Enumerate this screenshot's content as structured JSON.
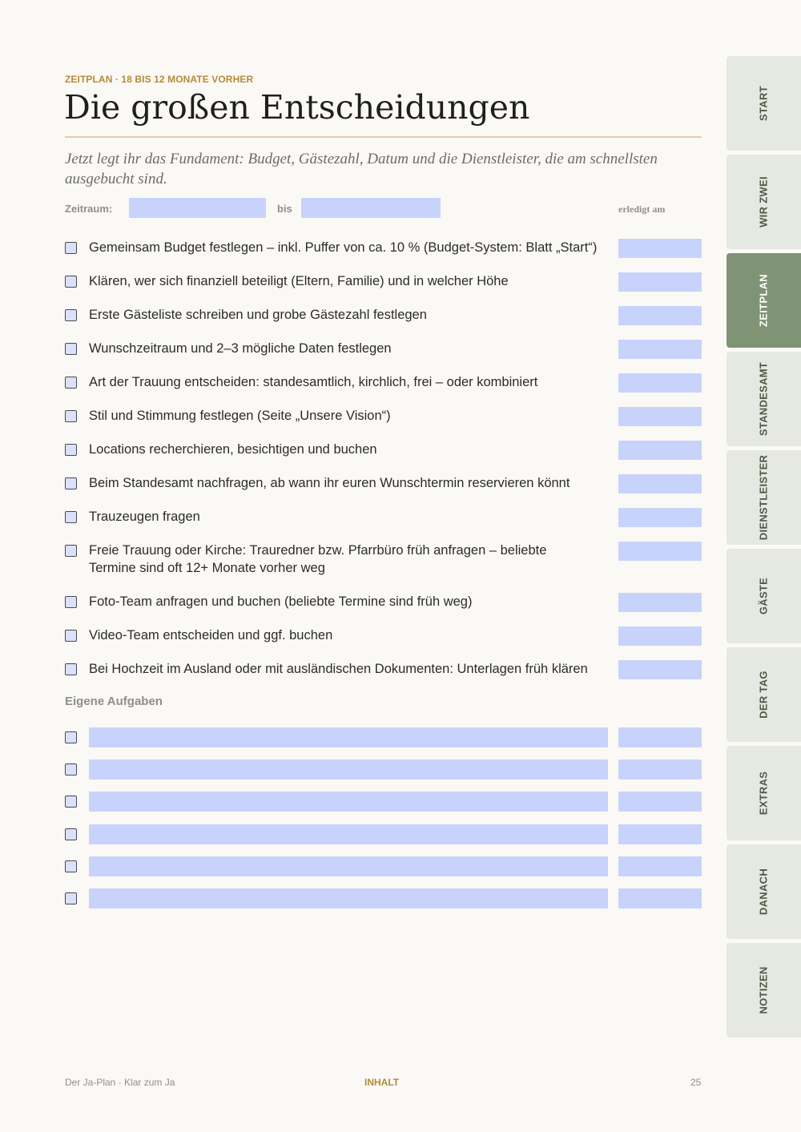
{
  "header": {
    "eyebrow": "ZEITPLAN · 18 BIS 12 MONATE VORHER",
    "title": "Die großen Entscheidungen",
    "intro": "Jetzt legt ihr das Fundament: Budget, Gästezahl, Datum und die Dienstleister, die am schnellsten ausgebucht sind."
  },
  "range": {
    "label": "Zeitraum:",
    "to_label": "bis",
    "done_header": "erledigt am"
  },
  "tasks": [
    "Gemeinsam Budget festlegen – inkl. Puffer von ca. 10 % (Budget-System: Blatt „Start“)",
    "Klären, wer sich finanziell beteiligt (Eltern, Familie) und in welcher Höhe",
    "Erste Gästeliste schreiben und grobe Gästezahl festlegen",
    "Wunschzeitraum und 2–3 mögliche Daten festlegen",
    "Art der Trauung entscheiden: standesamtlich, kirchlich, frei – oder kombiniert",
    "Stil und Stimmung festlegen (Seite „Unsere Vision“)",
    "Locations recherchieren, besichtigen und buchen",
    "Beim Standesamt nachfragen, ab wann ihr euren Wunschtermin reservieren könnt",
    "Trauzeugen fragen",
    "Freie Trauung oder Kirche: Trauredner bzw. Pfarrbüro früh anfragen – beliebte Termine sind oft 12+ Monate vorher weg",
    "Foto-Team anfragen und buchen (beliebte Termine sind früh weg)",
    "Video-Team entscheiden und ggf. buchen",
    "Bei Hochzeit im Ausland oder mit ausländischen Dokumenten: Unterlagen früh klären"
  ],
  "own_tasks": {
    "label": "Eigene Aufgaben"
  },
  "tabs": [
    "START",
    "WIR ZWEI",
    "ZEITPLAN",
    "STANDESAMT",
    "DIENSTLEISTER",
    "GÄSTE",
    "DER TAG",
    "EXTRAS",
    "DANACH",
    "NOTIZEN"
  ],
  "active_tab": "ZEITPLAN",
  "footer": {
    "left": "Der Ja-Plan · Klar zum Ja",
    "center": "INHALT",
    "page_number": "25"
  },
  "colors": {
    "accent": "#b58a3a",
    "field": "#c8d3fb",
    "tab_active": "#7f9474",
    "tab_inactive": "#e6e8e2"
  }
}
